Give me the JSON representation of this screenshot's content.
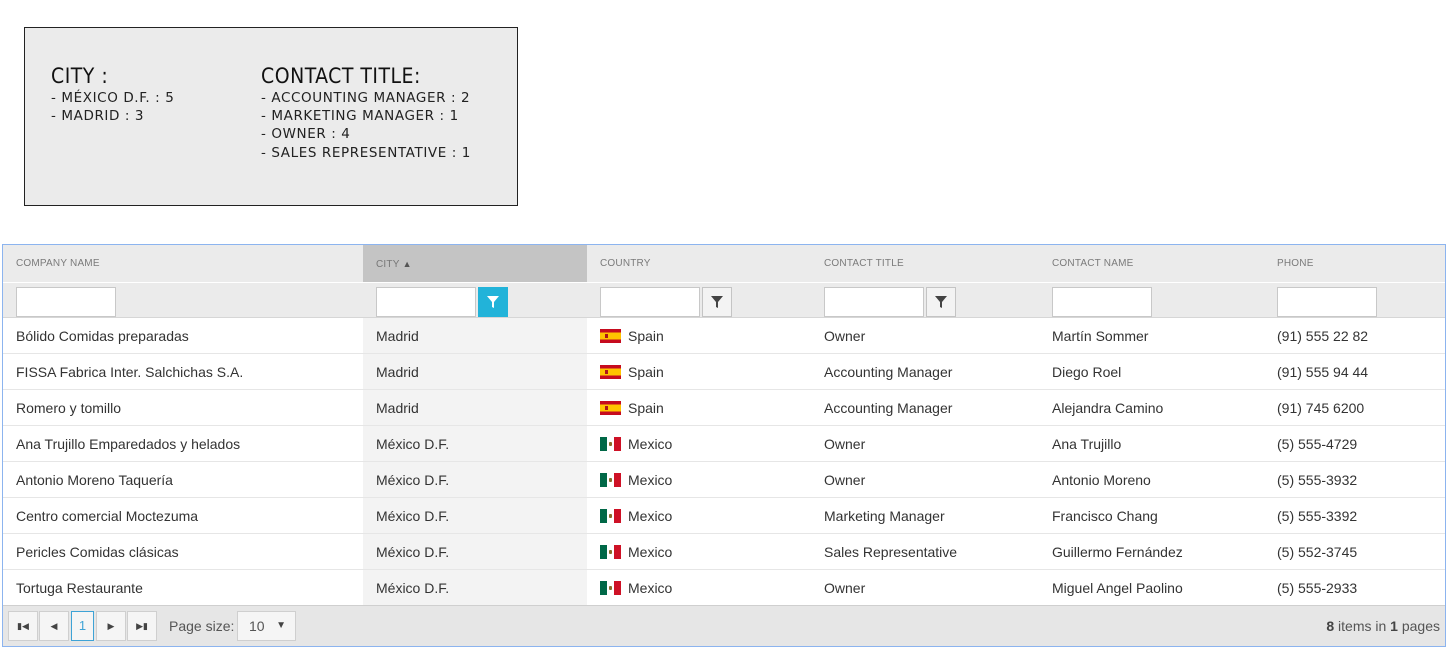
{
  "summary": {
    "city_heading": "CITY :",
    "city_items": [
      "- MÉXICO D.F. : 5",
      "- MADRID : 3"
    ],
    "title_heading": "CONTACT TITLE:",
    "title_items": [
      "- ACCOUNTING MANAGER : 2",
      "- MARKETING MANAGER : 1",
      "- OWNER : 4",
      "- SALES REPRESENTATIVE : 1"
    ]
  },
  "grid": {
    "columns": [
      "COMPANY NAME",
      "CITY",
      "COUNTRY",
      "CONTACT TITLE",
      "CONTACT NAME",
      "PHONE"
    ],
    "sorted_column": "CITY",
    "sort_indicator": "▲",
    "active_filter_color": "#22b3d9",
    "rows": [
      {
        "company": "Bólido Comidas preparadas",
        "city": "Madrid",
        "country": "Spain",
        "flag": "spain-flag-icon",
        "title": "Owner",
        "contact": "Martín Sommer",
        "phone": "(91) 555 22 82"
      },
      {
        "company": "FISSA Fabrica Inter. Salchichas S.A.",
        "city": "Madrid",
        "country": "Spain",
        "flag": "spain-flag-icon",
        "title": "Accounting Manager",
        "contact": "Diego Roel",
        "phone": "(91) 555 94 44"
      },
      {
        "company": "Romero y tomillo",
        "city": "Madrid",
        "country": "Spain",
        "flag": "spain-flag-icon",
        "title": "Accounting Manager",
        "contact": "Alejandra Camino",
        "phone": "(91) 745 6200"
      },
      {
        "company": "Ana Trujillo Emparedados y helados",
        "city": "México D.F.",
        "country": "Mexico",
        "flag": "mexico-flag-icon",
        "title": "Owner",
        "contact": "Ana Trujillo",
        "phone": "(5) 555-4729"
      },
      {
        "company": "Antonio Moreno Taquería",
        "city": "México D.F.",
        "country": "Mexico",
        "flag": "mexico-flag-icon",
        "title": "Owner",
        "contact": "Antonio Moreno",
        "phone": "(5) 555-3932"
      },
      {
        "company": "Centro comercial Moctezuma",
        "city": "México D.F.",
        "country": "Mexico",
        "flag": "mexico-flag-icon",
        "title": "Marketing Manager",
        "contact": "Francisco Chang",
        "phone": "(5) 555-3392"
      },
      {
        "company": "Pericles Comidas clásicas",
        "city": "México D.F.",
        "country": "Mexico",
        "flag": "mexico-flag-icon",
        "title": "Sales Representative",
        "contact": "Guillermo Fernández",
        "phone": "(5) 552-3745"
      },
      {
        "company": "Tortuga Restaurante",
        "city": "México D.F.",
        "country": "Mexico",
        "flag": "mexico-flag-icon",
        "title": "Owner",
        "contact": "Miguel Angel Paolino",
        "phone": "(5) 555-2933"
      }
    ]
  },
  "pager": {
    "first_icon": "first-page-icon",
    "prev_icon": "previous-page-icon",
    "current_page": "1",
    "next_icon": "next-page-icon",
    "last_icon": "last-page-icon",
    "page_size_label": "Page size:",
    "page_size_value": "10",
    "items_count": "8",
    "items_in_text": "items in",
    "pages_count": "1",
    "pages_text": "pages"
  }
}
